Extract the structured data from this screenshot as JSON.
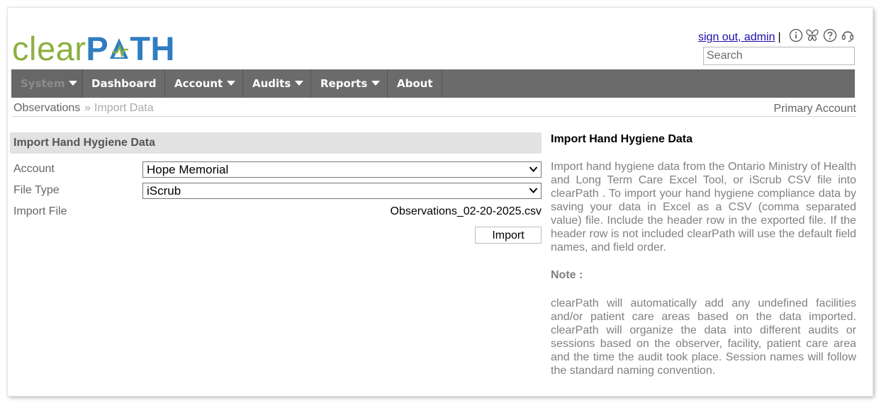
{
  "logo": {
    "part1": "clear",
    "part2_a": "P",
    "part2_b": "TH",
    "logo_icon": "checkmark-arrow"
  },
  "header": {
    "sign_out_label": "sign out, admin",
    "separator": "|",
    "icons": [
      "info-icon",
      "butterfly-icon",
      "help-icon",
      "headset-icon"
    ],
    "search_placeholder": "Search"
  },
  "nav": {
    "items": [
      {
        "label": "System",
        "has_caret": true,
        "disabled": true
      },
      {
        "label": "Dashboard",
        "has_caret": false
      },
      {
        "label": "Account",
        "has_caret": true
      },
      {
        "label": "Audits",
        "has_caret": true
      },
      {
        "label": "Reports",
        "has_caret": true
      },
      {
        "label": "About",
        "has_caret": false
      }
    ]
  },
  "breadcrumb": {
    "item1": "Observations",
    "separator": "»",
    "item2": "Import Data",
    "account_label": "Primary Account"
  },
  "form": {
    "title": "Import Hand Hygiene Data",
    "account_label": "Account",
    "account_value": "Hope Memorial",
    "filetype_label": "File Type",
    "filetype_value": "iScrub",
    "importfile_label": "Import File",
    "importfile_value": "Observations_02-20-2025.csv",
    "import_button": "Import"
  },
  "help": {
    "title": "Import Hand Hygiene Data",
    "body": "Import hand hygiene data from the Ontario Ministry of Health and Long Term Care Excel Tool, or iScrub CSV file into clearPath . To import your hand hygiene compliance data by saving your data in Excel as a CSV (comma separated value) file.   Include the header row in the exported file.  If the header row is not included clearPath will use the default field names, and field order.",
    "note_title": "Note :",
    "note_body": "clearPath will automatically add any undefined facilities and/or patient care areas based on the data imported. clearPath will organize the data into different audits or sessions based on the observer, facility, patient care area and the time the audit took place. Session names will follow the standard naming convention."
  },
  "colors": {
    "logo_green": "#8bb040",
    "logo_blue": "#2f7ec0",
    "nav_bg": "#6b6b6b",
    "link": "#1a0dab",
    "panel_header_bg": "#e2e2e2"
  }
}
